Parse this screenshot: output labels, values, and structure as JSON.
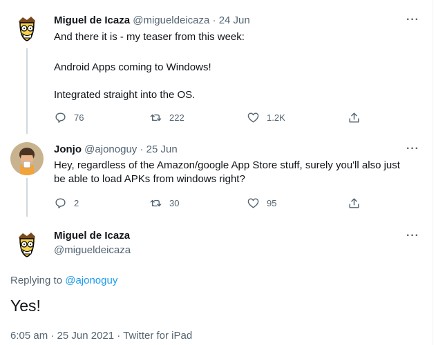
{
  "tweets": [
    {
      "name": "Miguel de Icaza",
      "handle": "@migueldeicaza",
      "sep": "·",
      "date": "24 Jun",
      "lines": [
        "And there it is - my teaser from this week:",
        "Android Apps coming to Windows!",
        "Integrated straight into the OS."
      ],
      "replies": "76",
      "retweets": "222",
      "likes": "1.2K"
    },
    {
      "name": "Jonjo",
      "handle": "@ajonoguy",
      "sep": "·",
      "date": "25 Jun",
      "lines": [
        "Hey, regardless of the Amazon/google App Store stuff, surely you'll also just",
        "be able to load APKs from windows right?"
      ],
      "replies": "2",
      "retweets": "30",
      "likes": "95"
    }
  ],
  "main": {
    "name": "Miguel de Icaza",
    "handle": "@migueldeicaza",
    "replying_prefix": "Replying to",
    "replying_to": "@ajonoguy",
    "text": "Yes!",
    "meta": "6:05 am · 25 Jun 2021 · Twitter for iPad"
  },
  "ui": {
    "more": "···",
    "icons": [
      "reply-icon",
      "retweet-icon",
      "like-icon",
      "share-icon",
      "more-icon"
    ],
    "colors": {
      "muted": "#536471",
      "link": "#1d9bf0",
      "thread_line": "#cfd9de"
    }
  }
}
